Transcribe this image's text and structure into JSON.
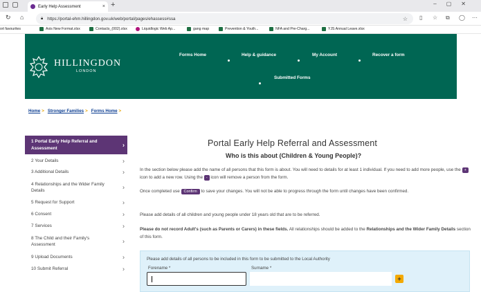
{
  "browser": {
    "tab_title": "Early Help Assessment",
    "tab_close": "×",
    "new_tab": "+",
    "url": "https://portal-ehm.hillingdon.gov.uk/web/portal/pages/ehassess#ssa",
    "favourites": [
      {
        "label": "ort favourites",
        "color": ""
      },
      {
        "label": "Axis New Format.xlsx",
        "color": "#1d6f42"
      },
      {
        "label": "Contacts_(002).xlsx",
        "color": "#1d6f42"
      },
      {
        "label": "Liquidlogic Web Ap...",
        "color": "#b0127a"
      },
      {
        "label": "gang map",
        "color": "#1d6f42"
      },
      {
        "label": "Prevention & Youth...",
        "color": "#1d6f42"
      },
      {
        "label": "NFA and Pre-Charg...",
        "color": "#1d6f42"
      },
      {
        "label": "YJS Annual Leave.xlsx",
        "color": "#1d6f42"
      }
    ]
  },
  "header": {
    "logo_text": "HILLINGDON",
    "logo_sub": "LONDON",
    "menu": [
      "Forms Home",
      "Help & guidance",
      "My Account",
      "Recover a form",
      "Submitted Forms"
    ]
  },
  "breadcrumb": [
    "Home",
    "Stronger Families",
    "Forms Home"
  ],
  "sidebar": [
    {
      "label": "1 Portal Early Help Referral and Assessment",
      "active": true
    },
    {
      "label": "2 Your Details"
    },
    {
      "label": "3 Additional Details"
    },
    {
      "label": "4 Relationships and the Wider Family Details"
    },
    {
      "label": "5 Request for Support"
    },
    {
      "label": "6 Consent"
    },
    {
      "label": "7 Services"
    },
    {
      "label": "8 The Child and their Family's Assessment"
    },
    {
      "label": "9 Upload Documents"
    },
    {
      "label": "10 Submit Referral"
    }
  ],
  "main": {
    "title": "Portal Early Help Referral and Assessment",
    "subtitle": "Who is this about (Children & Young People)?",
    "p1_a": "In the section below please add the name of all persons that this form is about. You will need to details for at least 1 individual. If you need to add more people, use the ",
    "p1_plus": "+",
    "p1_b": " icon to add a new row. Using the ",
    "p1_minus": "-",
    "p1_c": " icon will remove a person from the form.",
    "p2_a": "Once completed use ",
    "p2_confirm": "Confirm",
    "p2_b": " to save your changes. You will not be able to progress through the form until changes have been confirmed.",
    "p3": "Please add details of all children and young people under 18 years old that are to be referred.",
    "p4_bold1": "Please do not record Adult's (such as Parents or Carers) in these fields.",
    "p4_mid": " All relationships should be added to the ",
    "p4_bold2": "Relationships and the Wider Family Details",
    "p4_end": " section of this form."
  },
  "entry": {
    "note": "Please add details of all persons to be included in this form to be submitted to the Local Authority",
    "forename_label": "Forename *",
    "surname_label": "Surname *",
    "add_label": "+"
  }
}
